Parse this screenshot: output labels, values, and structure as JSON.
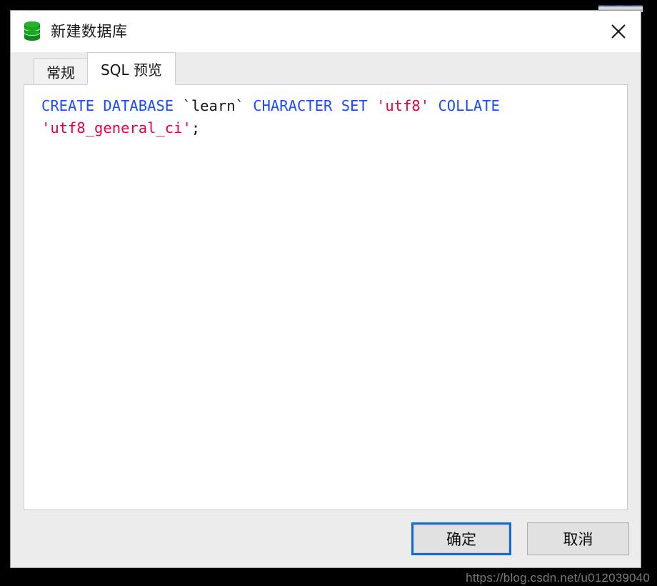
{
  "window": {
    "title": "新建数据库",
    "icon": "database-icon",
    "close_label": "✕"
  },
  "tabs": [
    {
      "label": "常规",
      "active": false,
      "name": "tab-general"
    },
    {
      "label": "SQL 预览",
      "active": true,
      "name": "tab-sql-preview"
    }
  ],
  "sql_preview": {
    "tokens": [
      {
        "text": "CREATE",
        "type": "keyword"
      },
      {
        "text": " ",
        "type": "plain"
      },
      {
        "text": "DATABASE",
        "type": "keyword"
      },
      {
        "text": " ",
        "type": "plain"
      },
      {
        "text": "`learn`",
        "type": "identifier"
      },
      {
        "text": " ",
        "type": "plain"
      },
      {
        "text": "CHARACTER",
        "type": "keyword"
      },
      {
        "text": " ",
        "type": "plain"
      },
      {
        "text": "SET",
        "type": "keyword"
      },
      {
        "text": " ",
        "type": "plain"
      },
      {
        "text": "'utf8'",
        "type": "string"
      },
      {
        "text": " ",
        "type": "plain"
      },
      {
        "text": "COLLATE",
        "type": "keyword"
      },
      {
        "text": " ",
        "type": "plain"
      },
      {
        "text": "'utf8_general_ci'",
        "type": "string"
      },
      {
        "text": ";",
        "type": "punctuation"
      }
    ],
    "full_text": "CREATE DATABASE `learn` CHARACTER SET 'utf8' COLLATE 'utf8_general_ci';"
  },
  "footer": {
    "ok_label": "确定",
    "cancel_label": "取消"
  },
  "watermark": {
    "text": "https://blog.csdn.net/u012039040"
  },
  "colors": {
    "keyword": "#1b4dff",
    "string": "#ec0043",
    "identifier": "#141414",
    "icon_green": "#159a1f",
    "focus_blue": "#0f6cd4",
    "dialog_bg": "#ececec",
    "panel_bg": "#ffffff"
  }
}
